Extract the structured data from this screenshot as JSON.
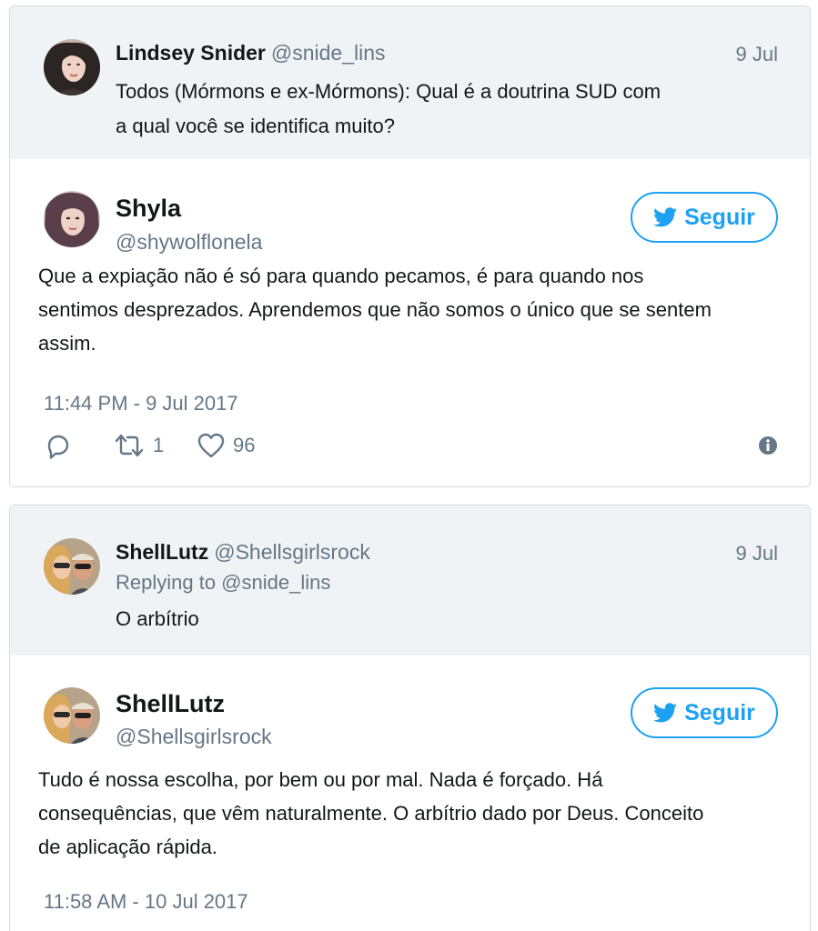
{
  "threads": [
    {
      "context": {
        "name": "Lindsey Snider",
        "handle": "@snide_lins",
        "date": "9 Jul",
        "text_line1": "Todos (Mórmons e ex-Mórmons): Qual é a doutrina SUD com",
        "text_line2": "a qual você se identifica muito?"
      },
      "main": {
        "name": "Shyla",
        "handle": "@shywolflonela",
        "follow_label": "Seguir",
        "text_line1": "Que a expiação não é só para quando pecamos, é para quando nos",
        "text_line2": "sentimos desprezados. Aprendemos que não somos o único que se sentem",
        "text_line3": "assim.",
        "timestamp": "11:44 PM - 9 Jul 2017",
        "retweets": "1",
        "likes": "96"
      }
    },
    {
      "context": {
        "name": "ShellLutz",
        "handle": "@Shellsgirlsrock",
        "date": "9 Jul",
        "replying": "Replying to @snide_lins",
        "text_line1": "O arbítrio"
      },
      "main": {
        "name": "ShellLutz",
        "handle": "@Shellsgirlsrock",
        "follow_label": "Seguir",
        "text_line1": "Tudo é nossa escolha, por bem ou por mal. Nada é forçado. Há",
        "text_line2": "consequências, que vêm naturalmente. O arbítrio dado por Deus. Conceito",
        "text_line3": "de aplicação rápida.",
        "timestamp": "11:58 AM - 10 Jul 2017"
      }
    }
  ],
  "colors": {
    "twitter_blue": "#1da1f2",
    "muted_text": "#657786",
    "context_bg": "#f0f3f6"
  },
  "icons": [
    "reply-icon",
    "retweet-icon",
    "heart-icon",
    "info-icon",
    "twitter-bird-icon"
  ]
}
